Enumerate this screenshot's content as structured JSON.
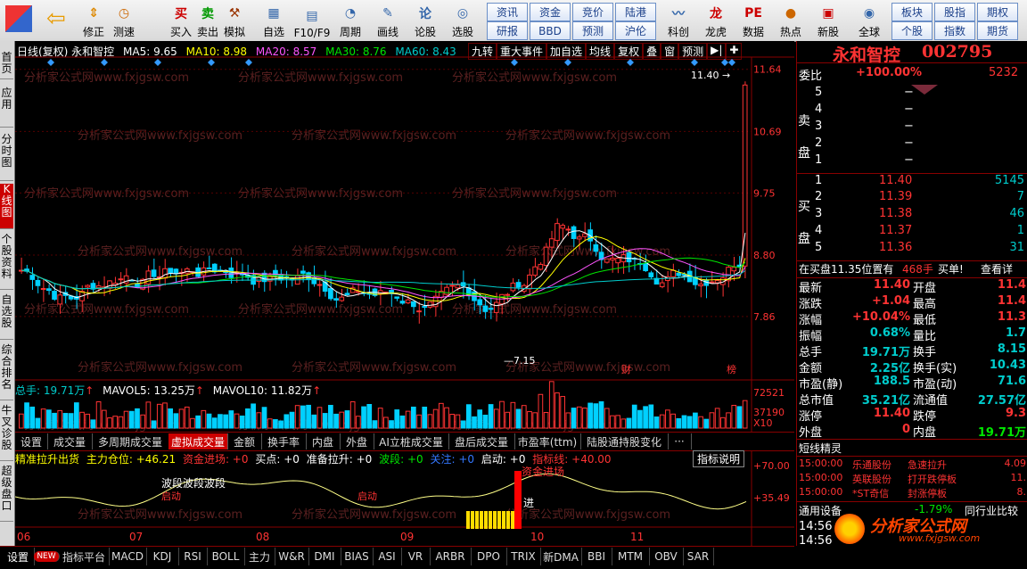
{
  "toolbar": {
    "buttons": [
      "修正",
      "测速",
      "买入",
      "卖出",
      "模拟",
      "自选",
      "F10/F9",
      "周期",
      "画线",
      "论股",
      "选股"
    ],
    "grid": [
      [
        "资讯",
        "资金",
        "竞价",
        "陆港"
      ],
      [
        "研报",
        "BBD",
        "预测",
        "沪伦"
      ]
    ],
    "buttons2": [
      "科创",
      "龙虎",
      "数据",
      "热点",
      "新股",
      "全球"
    ],
    "grid2": [
      [
        "板块",
        "股指",
        "期权"
      ],
      [
        "个股",
        "指数",
        "期货"
      ]
    ]
  },
  "leftbar": [
    "首页",
    "应用",
    "分时图",
    "K线图",
    "个股资料",
    "自选股",
    "综合排名",
    "牛叉诊股",
    "超级盘口"
  ],
  "chart": {
    "header": {
      "title": "日线(复权) 永和智控",
      "ma5": "MA5: 9.65",
      "ma10": "MA10: 8.98",
      "ma20": "MA20: 8.57",
      "ma30": "MA30: 8.76",
      "ma60": "MA60: 8.43"
    },
    "tools": [
      "九转",
      "重大事件",
      "加自选",
      "均线",
      "复权",
      "叠",
      "窗",
      "预测"
    ],
    "price_axis": [
      "11.64",
      "10.69",
      "9.75",
      "8.80",
      "7.86"
    ],
    "hi_label": "11.40",
    "lo_label": "7.15",
    "markers": [
      "财",
      "榜"
    ],
    "vol_header": {
      "label": "总手: 19.71万",
      "mavol5": "MAVOL5: 13.25万",
      "mavol10": "MAVOL10: 11.82万"
    },
    "vol_axis": [
      "72521",
      "37190",
      "X10"
    ],
    "tabs": [
      "设置",
      "成交量",
      "多周期成交量",
      "虚拟成交量",
      "金额",
      "换手率",
      "内盘",
      "外盘",
      "AI立桩成交量",
      "盘后成交量",
      "市盈率(ttm)",
      "陆股通持股变化",
      "···"
    ],
    "ind_header": {
      "name": "精准拉升出货",
      "pos": "主力仓位: +46.21",
      "zj": "资金进场: +0",
      "md": "买点: +0",
      "ready": "准备拉升: +0",
      "band": "波段: +0",
      "focus": "关注: +0",
      "start": "启动: +0",
      "indline": "指标线: +40.00"
    },
    "ind_btn": "指标说明",
    "ind_axis": [
      "+70.00",
      "+35.49"
    ],
    "ind_labels": [
      "波段波段波段",
      "启动",
      "启动",
      "资金进场",
      "进"
    ],
    "x_axis": [
      "06",
      "07",
      "08",
      "09",
      "10",
      "11"
    ],
    "watermark": "分析家公式网www.fxjgsw.com"
  },
  "bottom_tabs": [
    "设置",
    "NEW",
    "指标平台",
    "MACD",
    "KDJ",
    "RSI",
    "BOLL",
    "主力",
    "W&R",
    "DMI",
    "BIAS",
    "ASI",
    "VR",
    "ARBR",
    "DPO",
    "TRIX",
    "新DMA",
    "BBI",
    "MTM",
    "OBV",
    "SAR"
  ],
  "right": {
    "name": "永和智控",
    "code": "002795",
    "weibi_label": "委比",
    "weibi": "+100.00%",
    "weibi_v": "5232",
    "sell_label": "卖盘",
    "sells": [
      [
        "5",
        "−"
      ],
      [
        "4",
        "−"
      ],
      [
        "3",
        "−"
      ],
      [
        "2",
        "−"
      ],
      [
        "1",
        "−"
      ]
    ],
    "buy_label": "买盘",
    "buys": [
      [
        "1",
        "11.40",
        "5145"
      ],
      [
        "2",
        "11.39",
        "7"
      ],
      [
        "3",
        "11.38",
        "46"
      ],
      [
        "4",
        "11.37",
        "1"
      ],
      [
        "5",
        "11.36",
        "31"
      ]
    ],
    "queue": "在买盘11.35位置有",
    "queue_v": "468手",
    "queue_tag": "买单!",
    "queue_more": "查看详",
    "stats": [
      [
        "最新",
        "11.40",
        "开盘",
        "11.4"
      ],
      [
        "涨跌",
        "+1.04",
        "最高",
        "11.4"
      ],
      [
        "涨幅",
        "+10.04%",
        "最低",
        "11.3"
      ],
      [
        "振幅",
        "0.68%",
        "量比",
        "1.7"
      ],
      [
        "总手",
        "19.71万",
        "换手",
        "8.15"
      ],
      [
        "金额",
        "2.25亿",
        "换手(实)",
        "10.43"
      ],
      [
        "市盈(静)",
        "188.5",
        "市盈(动)",
        "71.6"
      ],
      [
        "总市值",
        "35.21亿",
        "流通值",
        "27.57亿"
      ],
      [
        "涨停",
        "11.40",
        "跌停",
        "9.3"
      ],
      [
        "外盘",
        "0",
        "内盘",
        "19.71万"
      ]
    ],
    "short_title": "短线精灵",
    "shorts": [
      [
        "15:00:00",
        "乐通股份",
        "急速拉升",
        "4.09"
      ],
      [
        "15:00:00",
        "英联股份",
        "打开跌停板",
        "11."
      ],
      [
        "15:00:00",
        "*ST奇信",
        "封涨停板",
        "8."
      ]
    ],
    "sector": "通用设备",
    "sector_pct": "-1.79%",
    "sector_btn": "同行业比较",
    "time": "14:56",
    "time2": "14:56",
    "logo_text": "分析家公式网",
    "logo_url": "www.fxjgsw.com"
  }
}
